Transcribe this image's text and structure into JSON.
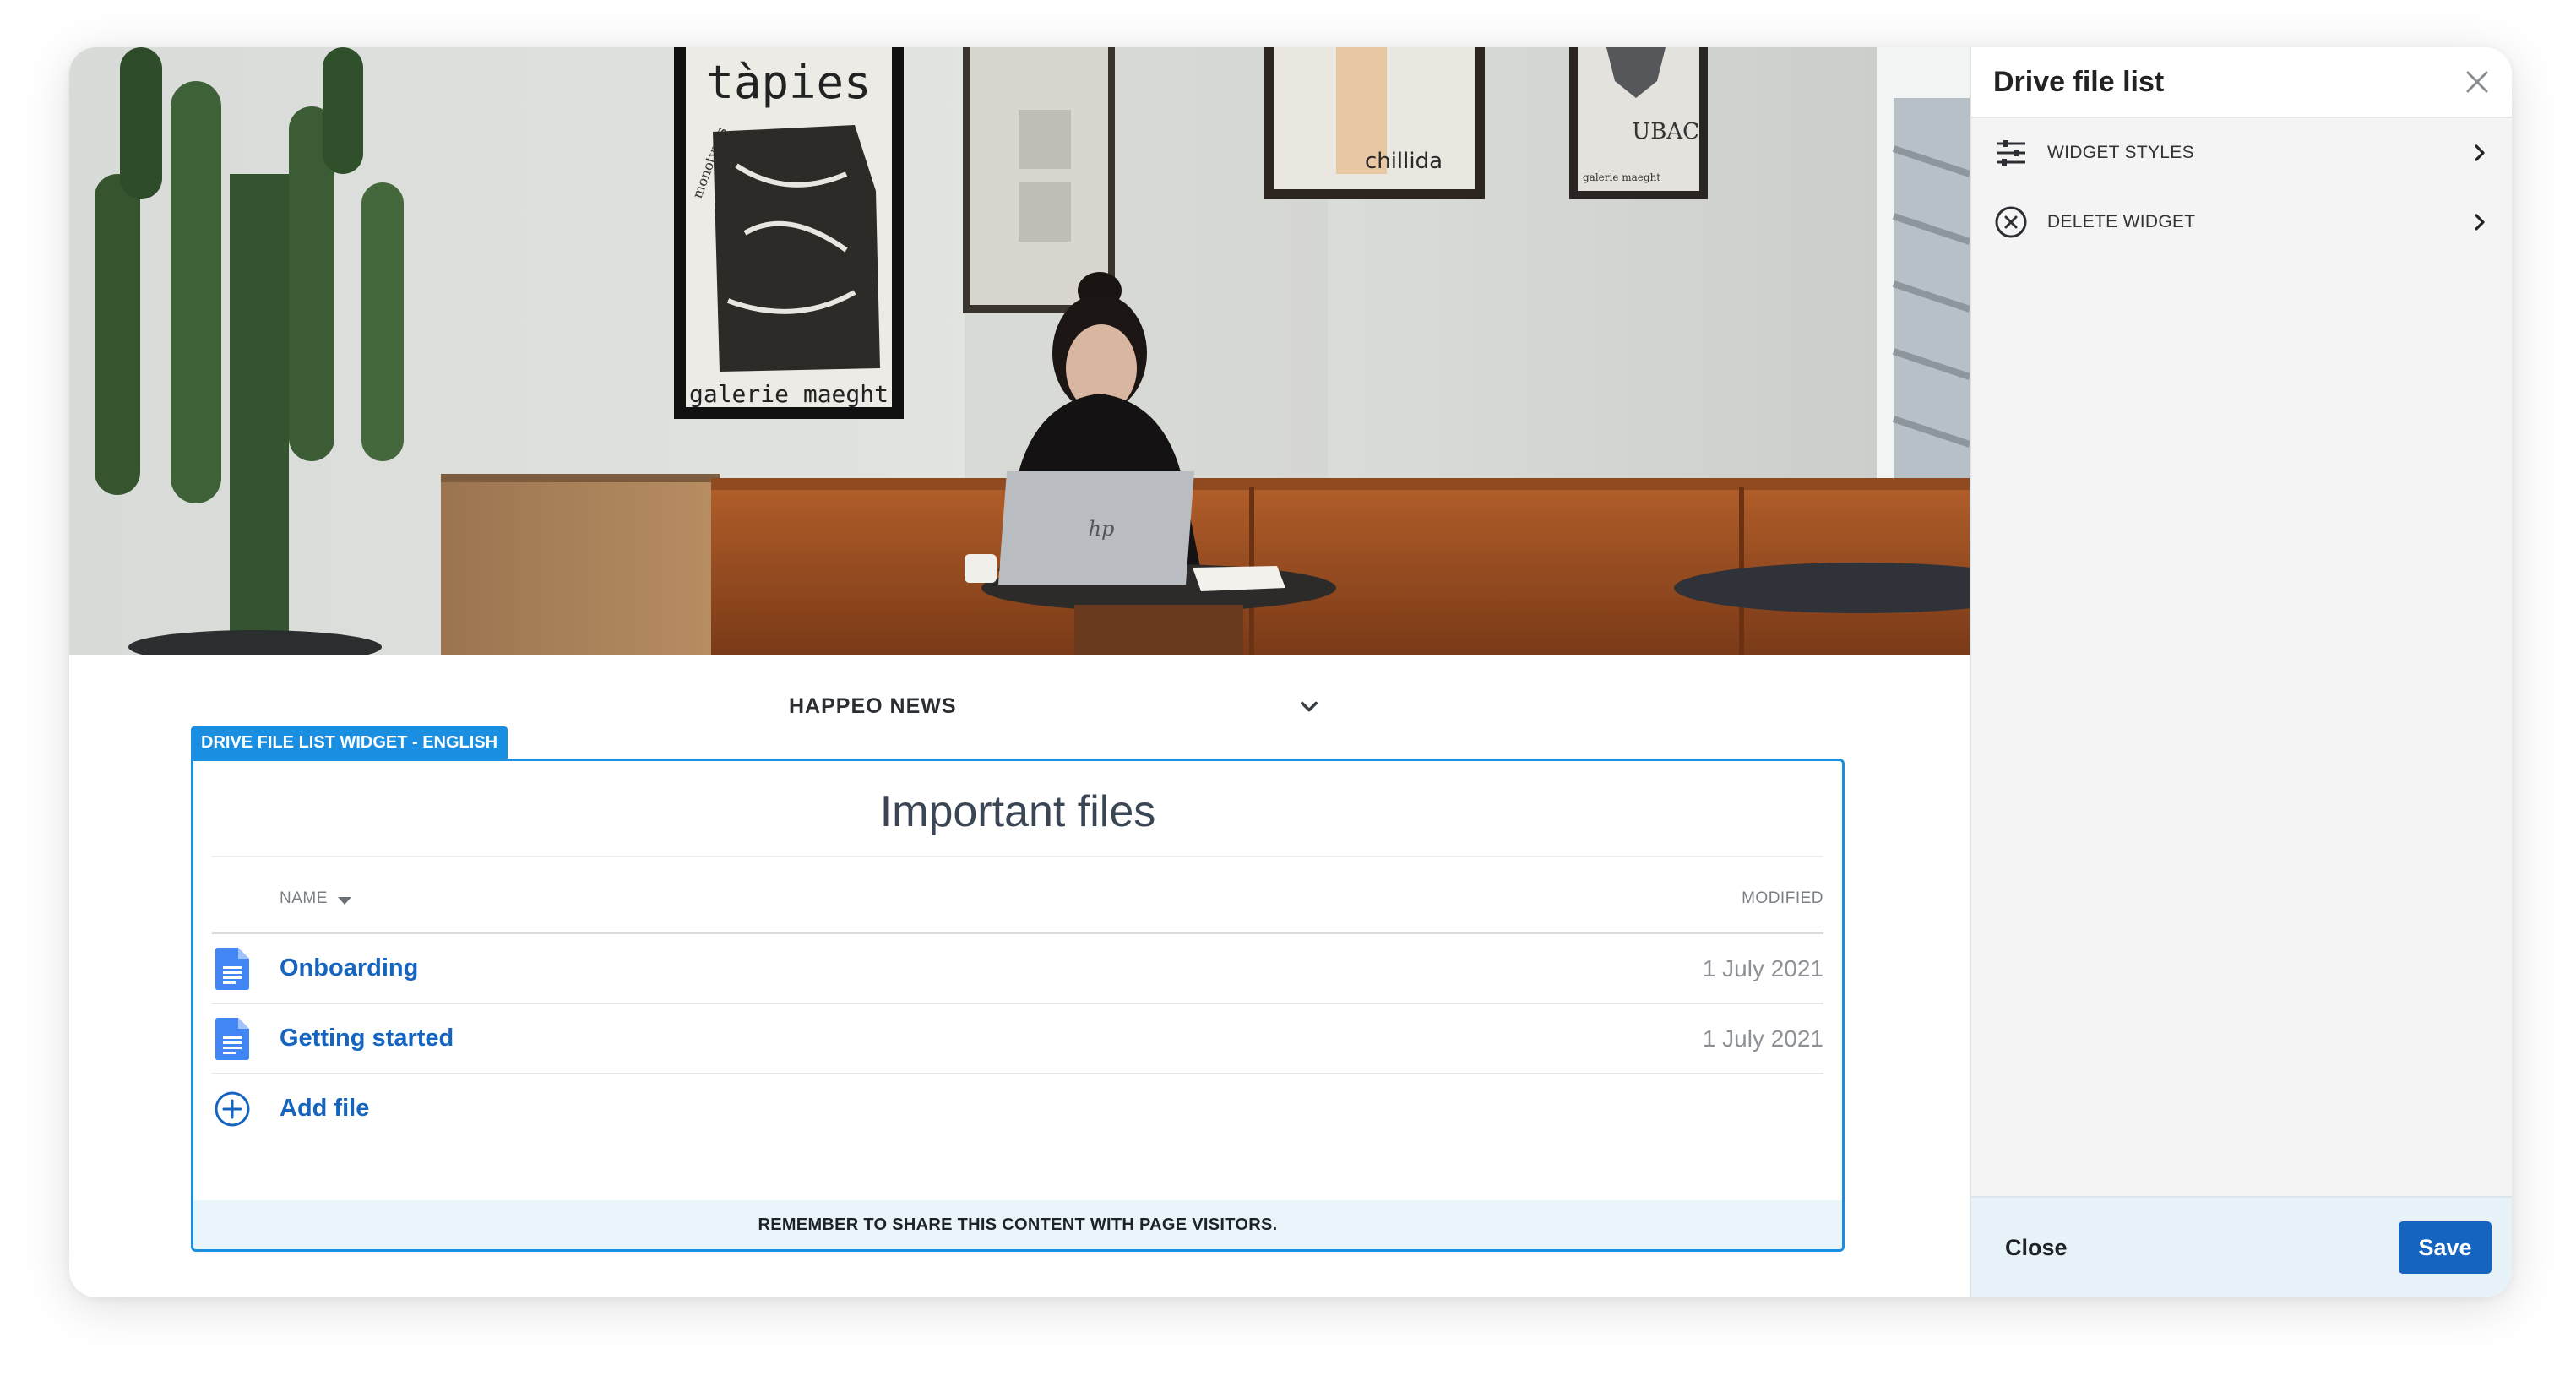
{
  "channel": {
    "label": "HAPPEO NEWS"
  },
  "widget": {
    "tag": "DRIVE FILE LIST WIDGET - ENGLISH",
    "title": "Important files",
    "columns": {
      "name": "NAME",
      "modified": "MODIFIED"
    },
    "files": [
      {
        "name": "Onboarding",
        "modified": "1 July 2021",
        "icon": "google-docs-icon"
      },
      {
        "name": "Getting started",
        "modified": "1 July 2021",
        "icon": "google-docs-icon"
      }
    ],
    "add_file": "Add file",
    "footer_note": "REMEMBER TO SHARE THIS CONTENT WITH PAGE VISITORS."
  },
  "panel": {
    "title": "Drive file list",
    "menu": [
      {
        "label": "WIDGET STYLES",
        "icon": "sliders-icon"
      },
      {
        "label": "DELETE WIDGET",
        "icon": "close-circle-icon"
      }
    ],
    "close_label": "Close",
    "save_label": "Save"
  },
  "photo": {
    "poster_1_title": "tàpies",
    "poster_1_side": "monotypes",
    "poster_1_footer": "galerie maeght",
    "poster_3_text": "chillida",
    "poster_4_text": "UBAC",
    "poster_4_footer": "galerie maeght",
    "laptop_logo": "hp"
  },
  "colors": {
    "accent": "#1a8ee0",
    "link": "#1565c0",
    "panel_bg": "#f4f4f4",
    "footer_bg": "#e9f4fb"
  }
}
